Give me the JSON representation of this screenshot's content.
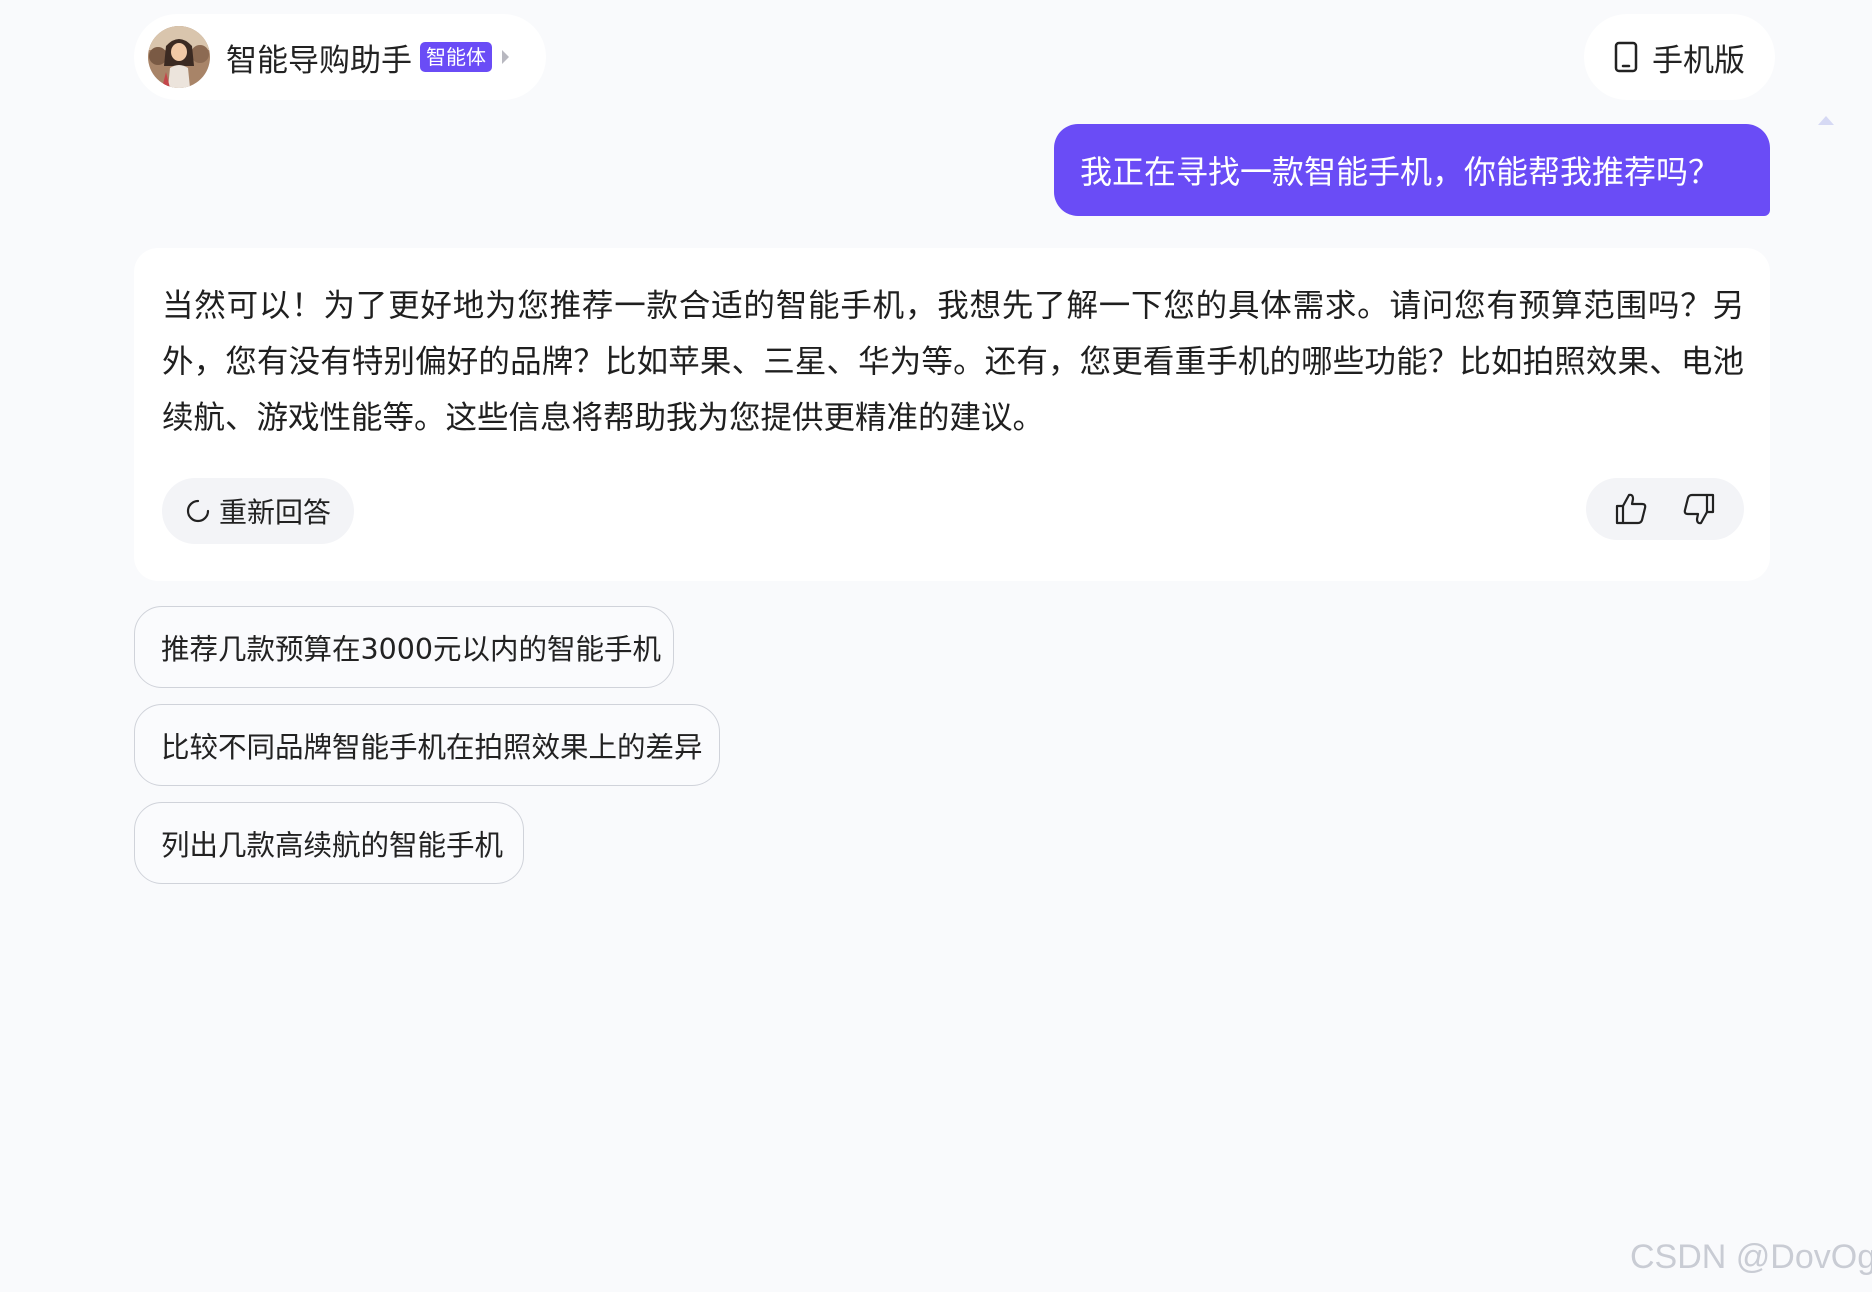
{
  "header": {
    "agent_name": "智能导购助手",
    "agent_badge": "智能体",
    "mobile_label": "手机版"
  },
  "conversation": {
    "user_message": "我正在寻找一款智能手机，你能帮我推荐吗？",
    "assistant_message": "当然可以！为了更好地为您推荐一款合适的智能手机，我想先了解一下您的具体需求。请问您有预算范围吗？另外，您有没有特别偏好的品牌？比如苹果、三星、华为等。还有，您更看重手机的哪些功能？比如拍照效果、电池续航、游戏性能等。这些信息将帮助我为您提供更精准的建议。",
    "regenerate_label": "重新回答"
  },
  "suggestions": [
    "推荐几款预算在3000元以内的智能手机",
    "比较不同品牌智能手机在拍照效果上的差异",
    "列出几款高续航的智能手机"
  ],
  "watermark": "CSDN @DovOg",
  "icons": {
    "agent_avatar": "avatar-photo",
    "badge_caret": "caret-right-icon",
    "mobile": "phone-icon",
    "regenerate": "refresh-icon",
    "like": "thumbs-up-icon",
    "dislike": "thumbs-down-icon"
  },
  "colors": {
    "accent": "#6a4cf6",
    "background": "#f9fafc",
    "card": "#ffffff"
  }
}
